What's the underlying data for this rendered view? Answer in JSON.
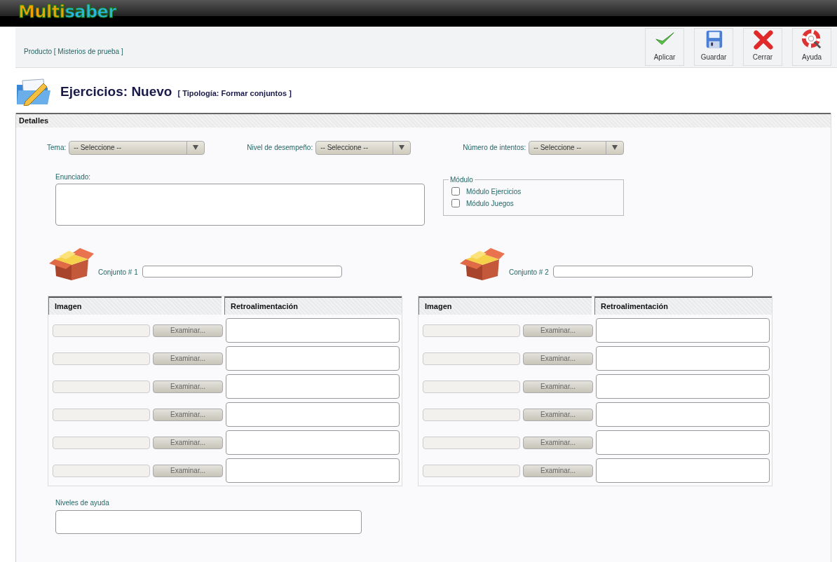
{
  "logo": {
    "parts": [
      {
        "text": "Multi",
        "color": "#f2a100"
      },
      {
        "text": "saber",
        "color": "#2bb5e3"
      }
    ]
  },
  "breadcrumb": "Producto [ Misterios de prueba ]",
  "toolbar": [
    {
      "kind": "apply",
      "label": "Aplicar"
    },
    {
      "kind": "save",
      "label": "Guardar"
    },
    {
      "kind": "close",
      "label": "Cerrar"
    },
    {
      "kind": "help",
      "label": "Ayuda"
    }
  ],
  "title": {
    "main": "Ejercicios: Nuevo",
    "sub": "[ Tipología: Formar conjuntos ]"
  },
  "panel": {
    "title": "Detalles",
    "filters": [
      {
        "label": "Tema:",
        "value": "-- Seleccione --"
      },
      {
        "label": "Nivel de desempeño:",
        "value": "-- Seleccione --"
      },
      {
        "label": "Número de intentos:",
        "value": "-- Seleccione --"
      }
    ],
    "statement": {
      "label": "Enunciado:"
    },
    "module": {
      "legend": "Módulo",
      "options": [
        {
          "label": "Módulo Ejercicios",
          "checked": false
        },
        {
          "label": "Módulo Juegos",
          "checked": false
        }
      ]
    },
    "sets": [
      {
        "label": "Conjunto # 1",
        "columns": [
          "Imagen",
          "Retroalimentación"
        ],
        "button": [
          "Examinar...",
          "Examinar...",
          "Examinar...",
          "Examinar...",
          "Examinar...",
          "Examinar..."
        ]
      },
      {
        "label": "Conjunto # 2",
        "columns": [
          "Imagen",
          "Retroalimentación"
        ],
        "button": [
          "Examinar...",
          "Examinar...",
          "Examinar...",
          "Examinar...",
          "Examinar...",
          "Examinar..."
        ]
      }
    ],
    "help_levels": {
      "label": "Niveles de ayuda"
    }
  }
}
